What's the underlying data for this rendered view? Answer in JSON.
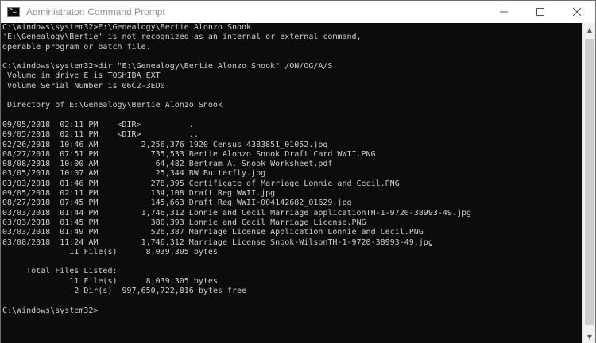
{
  "window": {
    "title": "Administrator: Command Prompt",
    "app_icon": "cmd-icon",
    "prompt_glyph": ">_",
    "controls": {
      "minimize": "minimize-icon",
      "maximize": "maximize-icon",
      "close": "close-icon"
    }
  },
  "console": {
    "lines": [
      "C:\\Windows\\system32>E:\\Genealogy\\Bertie Alonzo Snook",
      "'E:\\Genealogy\\Bertie' is not recognized as an internal or external command,",
      "operable program or batch file.",
      "",
      "C:\\Windows\\system32>dir \"E:\\Genealogy\\Bertie Alonzo Snook\" /ON/OG/A/S",
      " Volume in drive E is TOSHIBA EXT",
      " Volume Serial Number is 06C2-3ED0",
      "",
      " Directory of E:\\Genealogy\\Bertie Alonzo Snook",
      "",
      "09/05/2018  02:11 PM    <DIR>          .",
      "09/05/2018  02:11 PM    <DIR>          ..",
      "02/26/2018  10:46 AM         2,256,376 1920 Census 4383851_01052.jpg",
      "08/27/2018  07:51 PM           735,533 Bertie Alonzo Snook Draft Card WWII.PNG",
      "08/08/2018  10:00 AM            64,482 Bertram A. Snook Worksheet.pdf",
      "03/05/2018  10:07 AM            25,344 BW Butterfly.jpg",
      "03/03/2018  01:46 PM           278,395 Certificate of Marriage Lonnie and Cecil.PNG",
      "09/05/2018  02:11 PM           134,108 Draft Reg WWII.jpg",
      "08/27/2018  07:45 PM           145,663 Draft Reg WWII-004142682_01629.jpg",
      "03/03/2018  01:44 PM         1,746,312 Lonnie and Cecil Marriage applicationTH-1-9720-38993-49.jpg",
      "03/03/2018  01:45 PM           380,393 Lonnie and Cecil Marriage License.PNG",
      "03/03/2018  01:49 PM           526,387 Marriage License Application Lonnie and Cecil.PNG",
      "03/08/2018  11:24 AM         1,746,312 Marriage License Snook-WilsonTH-1-9720-38993-49.jpg",
      "              11 File(s)      8,039,305 bytes",
      "",
      "     Total Files Listed:",
      "              11 File(s)      8,039,305 bytes",
      "               2 Dir(s)  997,650,722,816 bytes free",
      "",
      "C:\\Windows\\system32>"
    ]
  },
  "scrollbar": {
    "up_arrow": "▲",
    "down_arrow": "▼",
    "up_icon": "scroll-up-icon",
    "down_icon": "scroll-down-icon"
  },
  "colors": {
    "console_bg": "#0c0c0c",
    "console_text": "#cccccc",
    "titlebar_bg": "#ffffff",
    "title_text": "#909090"
  }
}
